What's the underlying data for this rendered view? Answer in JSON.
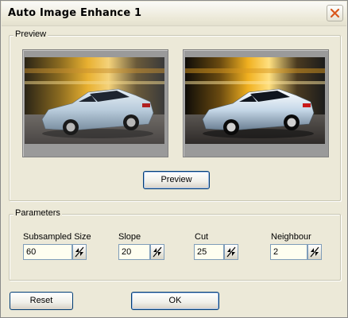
{
  "window": {
    "title": "Auto Image Enhance 1"
  },
  "preview_group": {
    "label": "Preview",
    "preview_button": "Preview"
  },
  "parameters_group": {
    "label": "Parameters",
    "fields": [
      {
        "label": "Subsampled Size",
        "value": "60"
      },
      {
        "label": "Slope",
        "value": "20"
      },
      {
        "label": "Cut",
        "value": "25"
      },
      {
        "label": "Neighbour",
        "value": "2"
      }
    ]
  },
  "footer": {
    "reset_label": "Reset",
    "ok_label": "OK"
  },
  "colors": {
    "dialog_bg": "#ece9d8",
    "button_border": "#003c74",
    "car_body": "#b9ccdc"
  }
}
